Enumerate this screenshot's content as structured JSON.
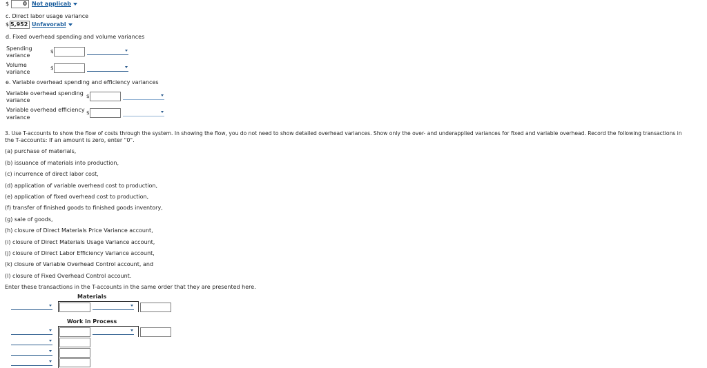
{
  "part_b": {
    "currency": "$",
    "value": "0",
    "selection": "Not applicab"
  },
  "part_c": {
    "heading": "c. Direct labor usage variance",
    "currency": "$",
    "value": "5,952",
    "selection": "Unfavorabl"
  },
  "part_d": {
    "heading": "d. Fixed overhead spending and volume variances",
    "rows": [
      {
        "label_line1": "Spending",
        "label_line2": "variance",
        "currency": "$"
      },
      {
        "label_line1": "Volume",
        "label_line2": "variance",
        "currency": "$"
      }
    ]
  },
  "part_e": {
    "heading": "e. Variable overhead spending and efficiency variances",
    "rows": [
      {
        "label_line1": "Variable overhead spending",
        "label_line2": "variance",
        "currency": "$"
      },
      {
        "label_line1": "Variable overhead efficiency",
        "label_line2": "variance",
        "currency": "$"
      }
    ]
  },
  "question3": {
    "line1": "3. Use T-accounts to show the flow of costs through the system. In showing the flow, you do not need to show detailed overhead variances. Show only the over- and underapplied variances for fixed and variable overhead. Record the following transactions in",
    "line2": "the T-accounts: If an amount is zero, enter \"0\".",
    "items": [
      "(a) purchase of materials,",
      "(b) issuance of materials into production,",
      "(c) incurrence of direct labor cost,",
      "(d) application of variable overhead cost to production,",
      "(e) application of fixed overhead cost to production,",
      "(f) transfer of finished goods to finished goods inventory,",
      "(g) sale of goods,",
      "(h) closure of Direct Materials Price Variance account,",
      "(i) closure of Direct Materials Usage Variance account,",
      "(j) closure of Direct Labor Efficiency Variance account,",
      "(k) closure of Variable Overhead Control account, and",
      "(l) closure of Fixed Overhead Control account."
    ],
    "instruction": "Enter these transactions in the T-accounts in the same order that they are presented here."
  },
  "t_accounts": [
    {
      "title": "Materials"
    },
    {
      "title": "Work in Process"
    }
  ]
}
